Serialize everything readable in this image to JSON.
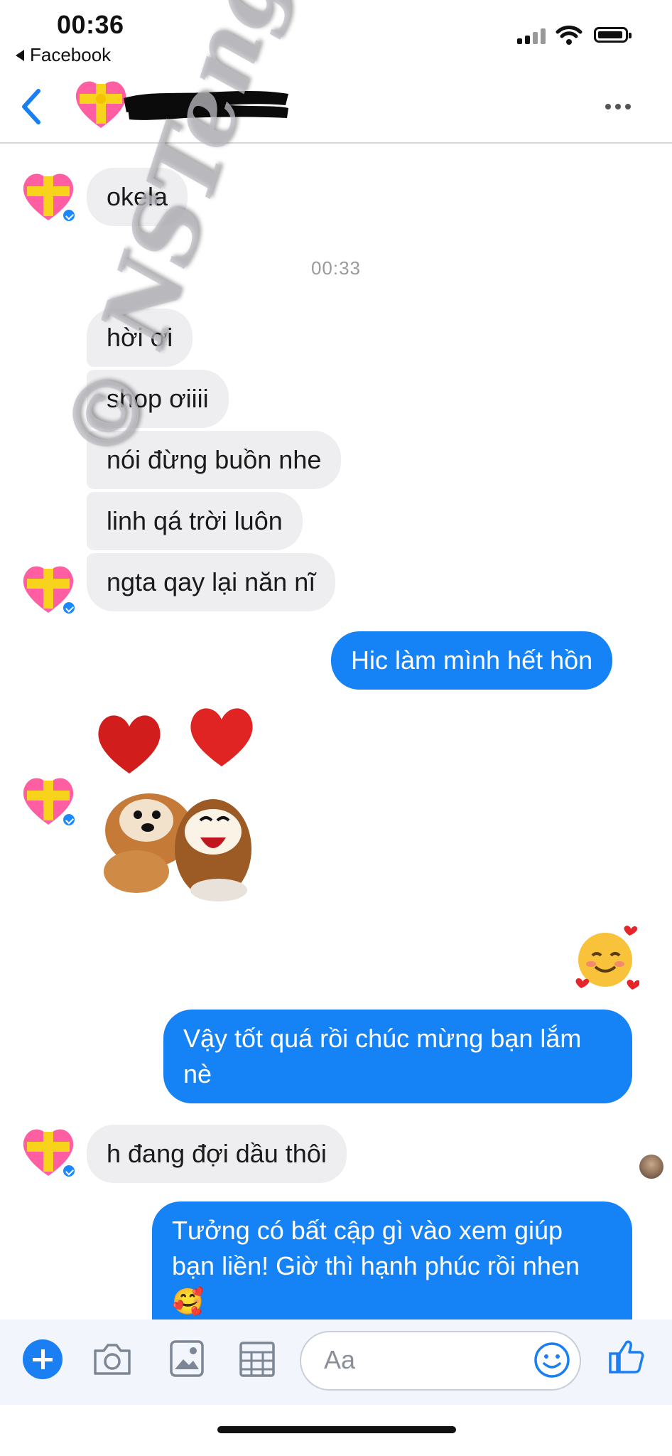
{
  "status_bar": {
    "time": "00:36",
    "back_app": "Facebook"
  },
  "header": {
    "contact_name": "",
    "more": "more-options"
  },
  "messages": [
    {
      "side": "in",
      "text": "okela"
    },
    {
      "timestamp": "00:33"
    },
    {
      "side": "in",
      "text": "hời ơi"
    },
    {
      "side": "in",
      "text": "shop ơiiii"
    },
    {
      "side": "in",
      "text": "nói đừng buồn nhe"
    },
    {
      "side": "in",
      "text": "linh qá trời luôn"
    },
    {
      "side": "in",
      "text": "ngta qay lại năn nĩ"
    },
    {
      "side": "out",
      "text": "Hic làm mình hết hồn"
    },
    {
      "side": "in",
      "sticker": "dogs-with-hearts-sticker"
    },
    {
      "side": "out",
      "emoji": "🥰"
    },
    {
      "side": "out",
      "text_lines": [
        "Vậy tốt quá rồi chúc mừng bạn lắm",
        "nè"
      ]
    },
    {
      "side": "in",
      "text": "h đang đợi dầu thôi"
    },
    {
      "side": "out",
      "text_lines": [
        "Tưởng có bất cập gì vào xem giúp",
        "bạn liền! Giờ thì hạnh phúc rồi nhen"
      ],
      "emoji": "🥰"
    }
  ],
  "watermark": "© NSTeng Shui",
  "composer": {
    "placeholder": "Aa",
    "icons": [
      "plus-icon",
      "camera-icon",
      "image-icon",
      "grid-icon",
      "smile-icon",
      "thumbs-up-icon"
    ]
  },
  "colors": {
    "accent": "#1582f5",
    "incoming_bubble": "#eeeef0",
    "composer_bg": "#f2f5fb"
  }
}
